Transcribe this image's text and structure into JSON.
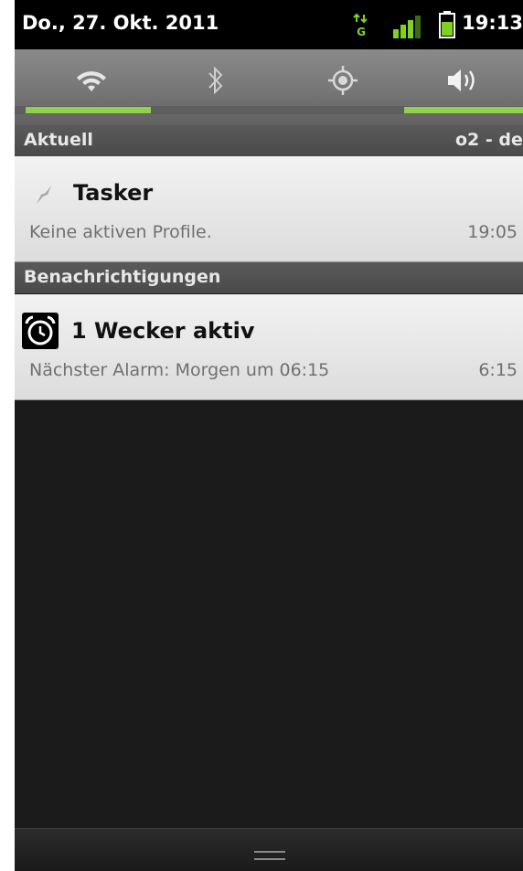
{
  "status_bar": {
    "date": "Do., 27. Okt. 2011",
    "time": "19:13",
    "icons": [
      "data-transfer-icon",
      "signal-icon",
      "battery-icon"
    ],
    "accent_color": "#7ed321"
  },
  "quick_settings": {
    "toggles": [
      {
        "icon": "wifi-icon",
        "enabled": true
      },
      {
        "icon": "bluetooth-icon",
        "enabled": false
      },
      {
        "icon": "gps-icon",
        "enabled": false
      },
      {
        "icon": "sound-icon",
        "enabled": true
      }
    ],
    "indicator_color": "#8fd14f"
  },
  "ongoing": {
    "header": "Aktuell",
    "carrier": "o2 - de",
    "item": {
      "icon": "tasker-icon",
      "title": "Tasker",
      "text": "Keine aktiven Profile.",
      "time": "19:05"
    }
  },
  "notifications": {
    "header": "Benachrichtigungen",
    "item": {
      "icon": "alarm-clock-icon",
      "title": "1 Wecker aktiv",
      "text": "Nächster Alarm: Morgen um 06:15",
      "time": "6:15"
    }
  },
  "handle": {
    "icon": "drag-handle-icon"
  }
}
